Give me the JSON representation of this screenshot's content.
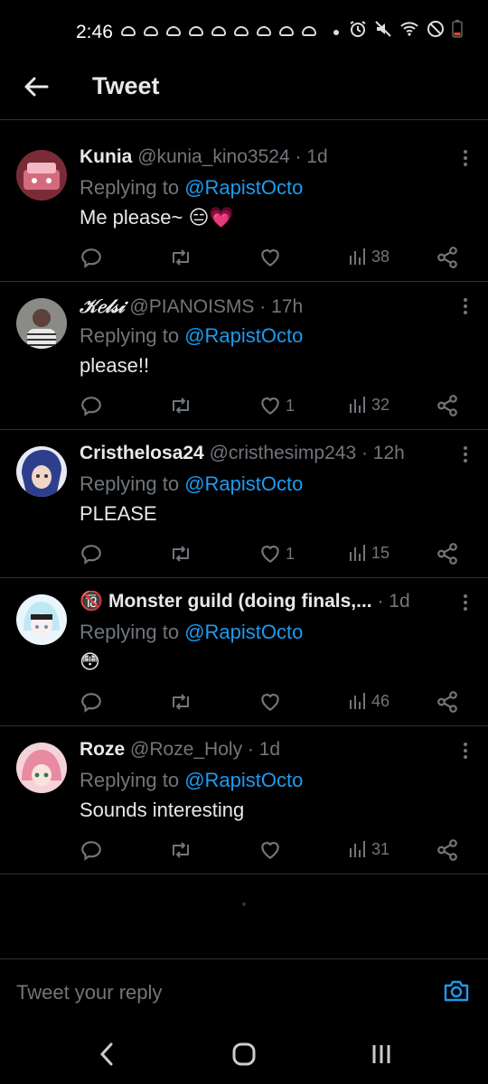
{
  "status_bar": {
    "time": "2:46"
  },
  "app_bar": {
    "title": "Tweet"
  },
  "replies": [
    {
      "name": "Kunia",
      "handle": "@kunia_kino3524",
      "age": "· 1d",
      "replying_prefix": "Replying to ",
      "replying_to": "@RapistOcto",
      "text": "Me please~ 😑💗",
      "replies": "",
      "retweets": "",
      "likes": "",
      "views": "38"
    },
    {
      "name": "𝒦𝑒𝓁𝓈𝒾",
      "handle": "@PIANOISMS",
      "age": "· 17h",
      "replying_prefix": "Replying to ",
      "replying_to": "@RapistOcto",
      "text": "please!!",
      "replies": "",
      "retweets": "",
      "likes": "1",
      "views": "32"
    },
    {
      "name": "Cristhelosa24",
      "handle": "@cristhesimp243",
      "age": "· 12h",
      "replying_prefix": "Replying to ",
      "replying_to": "@RapistOcto",
      "text": "PLEASE",
      "replies": "",
      "retweets": "",
      "likes": "1",
      "views": "15"
    },
    {
      "name": "🔞 Monster guild (doing finals,...",
      "handle": "",
      "age": "· 1d",
      "replying_prefix": "Replying to ",
      "replying_to": "@RapistOcto",
      "text": "😳",
      "replies": "",
      "retweets": "",
      "likes": "",
      "views": "46"
    },
    {
      "name": "Roze",
      "handle": "@Roze_Holy",
      "age": "· 1d",
      "replying_prefix": "Replying to ",
      "replying_to": "@RapistOcto",
      "text": "Sounds interesting",
      "replies": "",
      "retweets": "",
      "likes": "",
      "views": "31"
    }
  ],
  "composer": {
    "placeholder": "Tweet your reply"
  },
  "colors": {
    "accent": "#1d9bf0",
    "muted": "#71767b",
    "divider": "#2f3336",
    "background": "#000000"
  }
}
